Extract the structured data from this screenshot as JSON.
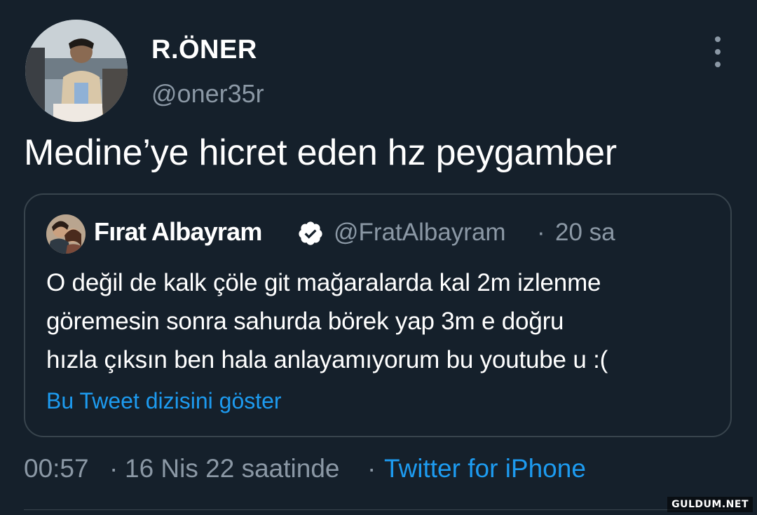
{
  "author": {
    "display_name": "R.ÖNER",
    "handle": "@oner35r",
    "avatar": "profile-photo"
  },
  "tweet": {
    "text": "Medine’ye hicret eden hz peygamber"
  },
  "quoted_tweet": {
    "display_name": "Fırat Albayram",
    "verified": true,
    "handle": "@FratAlbayram",
    "separator": "·",
    "time": "20 sa",
    "lines": [
      "O değil de kalk çöle git mağaralarda kal 2m izlenme",
      "göremesin sonra  sahurda börek yap 3m e doğru",
      "hızla çıksın ben hala anlayamıyorum bu youtube u :("
    ],
    "show_thread_link": "Bu Tweet dizisini göster"
  },
  "meta": {
    "time": "00:57",
    "sep1": "·",
    "date": "16 Nis 22 saatinde",
    "sep2": "·",
    "source": "Twitter for iPhone"
  },
  "watermark": "GULDUM.NET",
  "colors": {
    "background": "#15202b",
    "text": "#ffffff",
    "muted": "#8b98a5",
    "link": "#1d9bf0",
    "border": "#38444d"
  }
}
